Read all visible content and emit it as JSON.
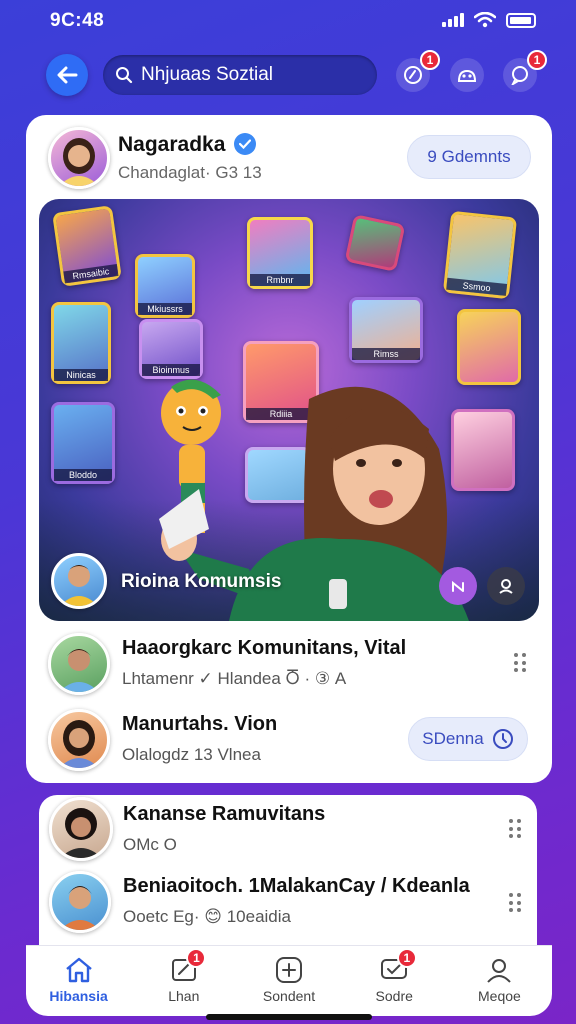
{
  "status_bar": {
    "time": "9C:48"
  },
  "top_bar": {
    "search_text": "Nhjuaas Soztial",
    "notification_badges": [
      "1",
      "1"
    ]
  },
  "profile": {
    "name": "Nagaradka",
    "subtitle": "Chandaglat· G3 13",
    "action_label": "9 Gdemnts"
  },
  "hero": {
    "caption": "Rioina Komumsis",
    "tile_labels": [
      "Rmsaibic",
      "Mkiussrs",
      "Rmbnr",
      "Ssmoo",
      "Ninicas",
      "Bioinmus",
      "Rimss",
      "Bloddo",
      "Rdiiia"
    ]
  },
  "list_main": [
    {
      "title": "Haaorgkarc Komunitans, Vital",
      "subtitle": "Lhtamenr ✓ Hlandea Ⴃ · ③ A"
    },
    {
      "title": "Manurtahs. Vion",
      "subtitle": "Olalogdz 13 Vlnea",
      "action_label": "SDenna"
    }
  ],
  "list_second": [
    {
      "title": "Kananse Ramuvitans",
      "subtitle": "OMc O"
    },
    {
      "title": "Beniaoitoch. 1MalakanCay / Kdeanla",
      "subtitle": "Ooetc Eg· 😊 10eaidia"
    }
  ],
  "tabs": [
    {
      "label": "Hibansia",
      "icon": "home-icon",
      "active": true,
      "badge": ""
    },
    {
      "label": "Lhan",
      "icon": "edit-icon",
      "active": false,
      "badge": "1"
    },
    {
      "label": "Sondent",
      "icon": "add-icon",
      "active": false,
      "badge": ""
    },
    {
      "label": "Sodre",
      "icon": "message-icon",
      "active": false,
      "badge": "1"
    },
    {
      "label": "Meqoe",
      "icon": "profile-icon",
      "active": false,
      "badge": ""
    }
  ],
  "colors": {
    "accent": "#2f5fe0",
    "badge": "#e8293a",
    "background": "#4a37d6"
  }
}
